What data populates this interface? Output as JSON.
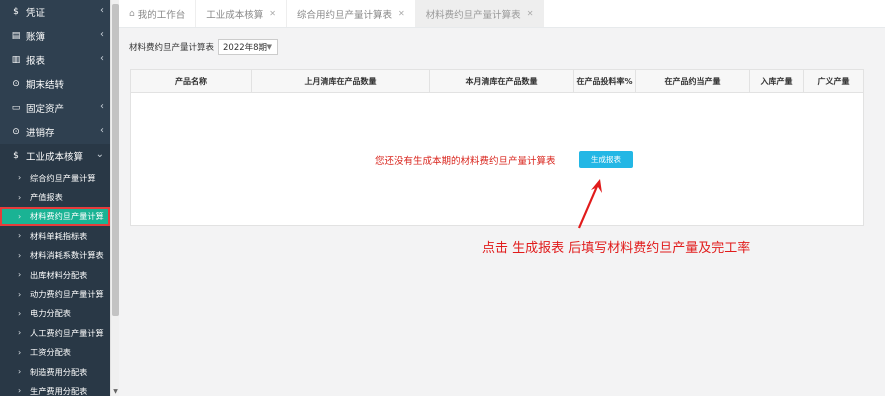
{
  "sidebar": {
    "items": [
      {
        "label": "凭证",
        "icon": "$"
      },
      {
        "label": "账簿",
        "icon": "▤"
      },
      {
        "label": "报表",
        "icon": "▥"
      },
      {
        "label": "期末结转",
        "icon": "⊙"
      },
      {
        "label": "固定资产",
        "icon": "▭"
      },
      {
        "label": "进销存",
        "icon": "⊙"
      },
      {
        "label": "工业成本核算",
        "icon": "$"
      }
    ],
    "sub_items": [
      "综合约旦产量计算",
      "产值报表",
      "材料费约旦产量计算",
      "材料单耗指标表",
      "材料消耗系数计算表",
      "出库材料分配表",
      "动力费约旦产量计算",
      "电力分配表",
      "人工费约旦产量计算",
      "工资分配表",
      "制造费用分配表",
      "生产费用分配表"
    ],
    "active_sub_index": 2
  },
  "tabs": [
    {
      "label": "我的工作台"
    },
    {
      "label": "工业成本核算"
    },
    {
      "label": "综合用约旦产量计算表"
    },
    {
      "label": "材料费约旦产量计算表"
    }
  ],
  "toolbar": {
    "label": "材料费约旦产量计算表",
    "period": "2022年8期"
  },
  "table": {
    "columns": [
      "产品名称",
      "上月清库在产品数量",
      "本月清库在产品数量",
      "在产品投料率%",
      "在产品约当产量",
      "入库产量",
      "广义产量"
    ]
  },
  "empty_state": {
    "message": "您还没有生成本期的材料费约旦产量计算表",
    "button": "生成报表"
  },
  "annotation": "点击  生成报表 后填写材料费约旦产量及完工率",
  "colors": {
    "sidebar_bg": "#2f4050",
    "active_item": "#1ab394",
    "button": "#23b7e5",
    "annotation": "#e11b1b"
  }
}
